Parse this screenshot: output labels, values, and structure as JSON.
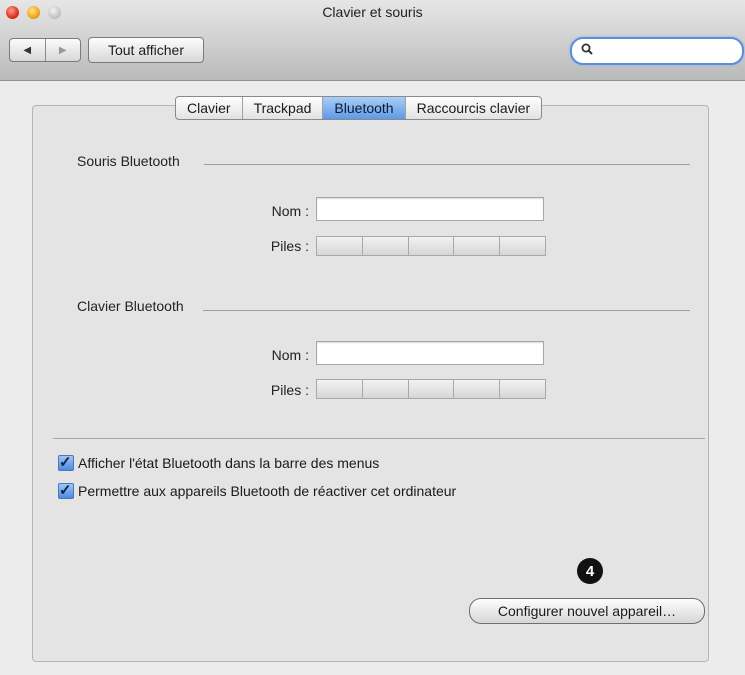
{
  "window": {
    "title": "Clavier et souris"
  },
  "toolbar": {
    "show_all_label": "Tout afficher",
    "back_icon": "chevron-left-icon",
    "forward_icon": "chevron-right-icon",
    "search_placeholder": ""
  },
  "tabs": [
    {
      "label": "Clavier",
      "active": false
    },
    {
      "label": "Trackpad",
      "active": false
    },
    {
      "label": "Bluetooth",
      "active": true
    },
    {
      "label": "Raccourcis clavier",
      "active": false
    }
  ],
  "mouse_section": {
    "title": "Souris Bluetooth",
    "name_label": "Nom :",
    "name_value": "",
    "battery_label": "Piles :"
  },
  "keyboard_section": {
    "title": "Clavier Bluetooth",
    "name_label": "Nom :",
    "name_value": "",
    "battery_label": "Piles :"
  },
  "options": [
    {
      "label": "Afficher l'état Bluetooth dans la barre des menus",
      "checked": true
    },
    {
      "label": "Permettre aux appareils Bluetooth de réactiver cet ordinateur",
      "checked": true
    }
  ],
  "badge": "4",
  "setup_button": "Configurer nouvel appareil…",
  "colors": {
    "accent": "#5e9ae6",
    "search_focus": "#5a8fd8"
  }
}
